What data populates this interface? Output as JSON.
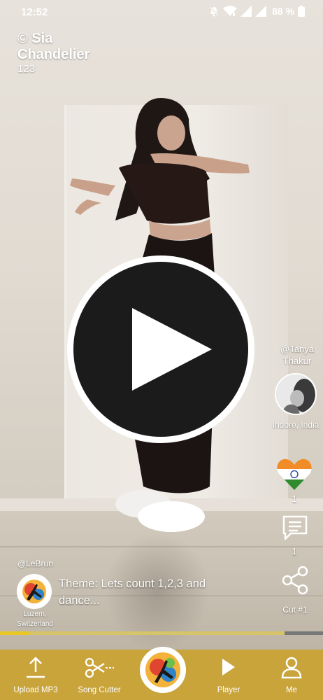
{
  "status_bar": {
    "time": "12:52",
    "battery": "88 %",
    "icons": [
      "mute-icon",
      "wifi-icon",
      "signal-icon",
      "signal-roaming-icon",
      "battery-icon"
    ]
  },
  "song": {
    "artist": "© Sia",
    "title": "Chandelier",
    "count": "123"
  },
  "creator": {
    "handle": "@Tanya Thakur",
    "location": "Indore, India"
  },
  "actions": {
    "likes": "1",
    "comments": "1",
    "share_label": "Cut #1"
  },
  "uploader": {
    "handle": "@LeBrun",
    "location": "Luzern, Switzerland",
    "theme": "Theme: Lets count 1,2,3 and dance..."
  },
  "progress": {
    "played_fraction": 0.09,
    "buffer_fraction": 0.88
  },
  "nav": {
    "items": [
      {
        "label": "Upload MP3",
        "icon": "upload-icon"
      },
      {
        "label": "Song Cutter",
        "icon": "scissors-icon"
      },
      {
        "label": "Player",
        "icon": "play-icon"
      },
      {
        "label": "Me",
        "icon": "person-icon"
      }
    ]
  },
  "colors": {
    "accent": "#e9c826",
    "nav_bg": "#c9a43a",
    "play_button": "#1b1b1b"
  }
}
